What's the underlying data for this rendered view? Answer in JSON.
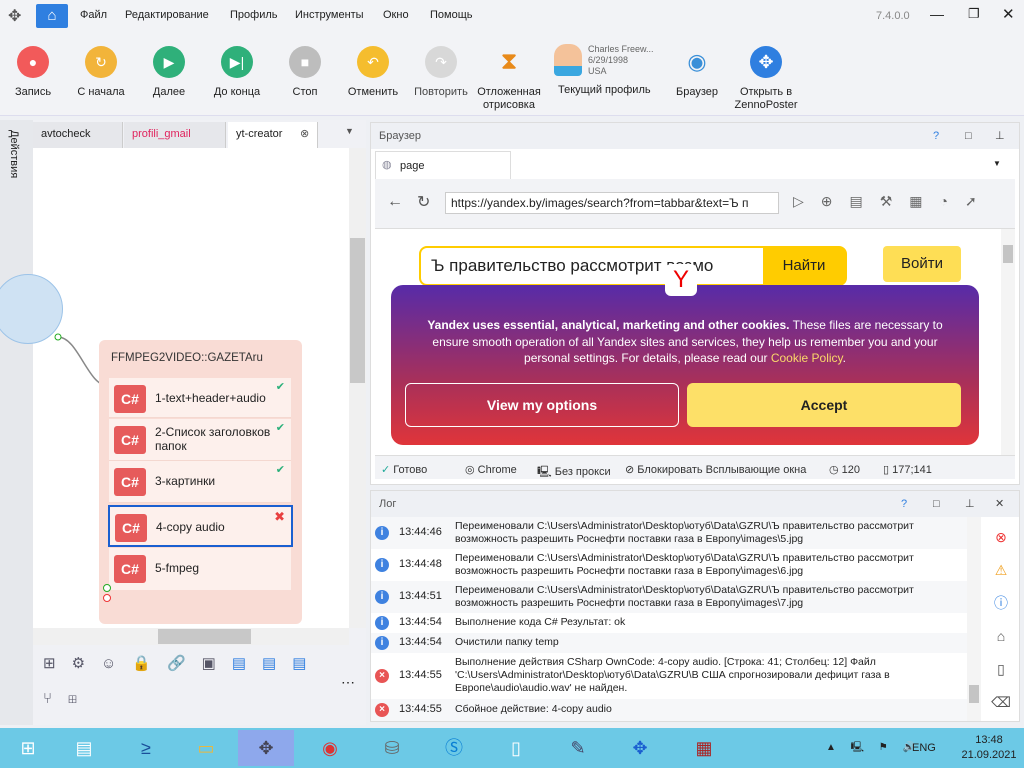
{
  "titlebar": {
    "menu": [
      "Файл",
      "Редактирование",
      "Профиль",
      "Инструменты",
      "Окно",
      "Помощь"
    ],
    "version": "7.4.0.0"
  },
  "toolbar": {
    "buttons": [
      {
        "label": "Запись",
        "color": "#f25a5a"
      },
      {
        "label": "С начала",
        "color": "#f2b43a"
      },
      {
        "label": "Далее",
        "color": "#2fb07a"
      },
      {
        "label": "До конца",
        "color": "#2fb07a"
      },
      {
        "label": "Стоп",
        "color": "#bdbdbd"
      },
      {
        "label": "Отменить",
        "color": "#f5bd2e"
      },
      {
        "label": "Повторить",
        "color": "#d8d8d8"
      },
      {
        "label": "Отложенная отрисовка"
      }
    ],
    "profile": {
      "name": "Charles Freew...",
      "dob": "6/29/1998",
      "country": "USA",
      "label": "Текущий профиль"
    },
    "browser_label": "Браузер",
    "open_label": "Открыть в ZennoPoster"
  },
  "side": {
    "actions_label": "Действия"
  },
  "project": {
    "tabs": [
      "avtocheck",
      "profili_gmail",
      "yt-creator"
    ],
    "group_title": "FFMPEG2VIDEO::GAZETAru",
    "cs_label": "C#",
    "nodes": [
      {
        "label": "1-text+header+audio",
        "status": "✔"
      },
      {
        "label": "2-Список заголовков папок",
        "status": "✔"
      },
      {
        "label": "3-картинки",
        "status": "✔"
      },
      {
        "label": "4-copy audio",
        "status": "✖"
      },
      {
        "label": "5-fmpeg",
        "status": ""
      }
    ]
  },
  "browser": {
    "title": "Браузер",
    "tab": "page",
    "url": "https://yandex.by/images/search?from=tabbar&text=Ъ п",
    "search_value": "Ъ правительство рассмотрит возмо",
    "search_button": "Найти",
    "login_button": "Войти",
    "logo": "Y",
    "cookie_bold": "Yandex uses essential, analytical, marketing and other cookies.",
    "cookie_text": " These files are necessary to ensure smooth operation of all Yandex sites and services, they help us remember you and your personal settings. For details, please read our ",
    "cookie_link": "Cookie Policy",
    "cookie_end": ".",
    "options_button": "View my options",
    "accept_button": "Accept",
    "status": {
      "ready": "Готово",
      "engine": "Chrome",
      "proxy": "Без прокси",
      "popups": "Блокировать Всплывающие окна",
      "timeout": "120",
      "coords": "177;141"
    }
  },
  "log": {
    "title": "Лог",
    "rows": [
      {
        "type": "info",
        "time": "13:44:46",
        "msg": "Переименовали C:\\Users\\Administrator\\Desktop\\ютуб\\Data\\GZRU\\Ъ правительство рассмотрит возможность разрешить Роснефти поставки газа в Европу\\images\\5.jpg"
      },
      {
        "type": "info",
        "time": "13:44:48",
        "msg": "Переименовали C:\\Users\\Administrator\\Desktop\\ютуб\\Data\\GZRU\\Ъ правительство рассмотрит возможность разрешить Роснефти поставки газа в Европу\\images\\6.jpg"
      },
      {
        "type": "info",
        "time": "13:44:51",
        "msg": "Переименовали C:\\Users\\Administrator\\Desktop\\ютуб\\Data\\GZRU\\Ъ правительство рассмотрит возможность разрешить Роснефти поставки газа в Европу\\images\\7.jpg"
      },
      {
        "type": "info",
        "time": "13:44:54",
        "msg": "Выполнение кода C#  Результат: ok"
      },
      {
        "type": "info",
        "time": "13:44:54",
        "msg": "Очистили папку temp"
      },
      {
        "type": "error",
        "time": "13:44:55",
        "msg": "Выполнение действия CSharp OwnCode: 4-copy audio. [Строка: 41; Столбец: 12] Файл 'C:\\Users\\Administrator\\Desktop\\ютуб\\Data\\GZRU\\В США спрогнозировали дефицит газа в Европе\\audio\\audio.wav' не найден."
      },
      {
        "type": "error",
        "time": "13:44:55",
        "msg": "Сбойное действие: 4-copy audio"
      }
    ]
  },
  "taskbar": {
    "lang": "ENG",
    "time": "13:48",
    "date": "21.09.2021"
  }
}
